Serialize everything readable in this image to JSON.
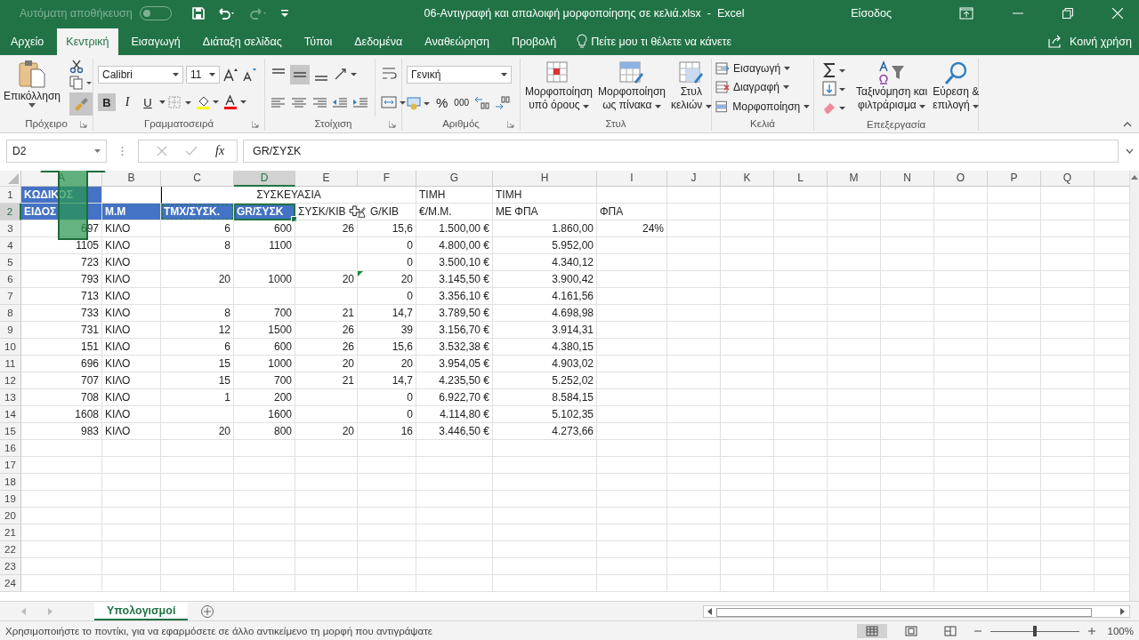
{
  "title_bar": {
    "autosave_label": "Αυτόματη αποθήκευση",
    "autosave_on": false,
    "title": "06-Αντιγραφή και απαλοιφή μορφοποίησης σε κελιά.xlsx  -  Excel",
    "sign_in": "Είσοδος"
  },
  "menu_tabs": [
    {
      "label": "Αρχείο",
      "selected": false
    },
    {
      "label": "Κεντρική",
      "selected": true
    },
    {
      "label": "Εισαγωγή",
      "selected": false
    },
    {
      "label": "Διάταξη σελίδας",
      "selected": false
    },
    {
      "label": "Τύποι",
      "selected": false
    },
    {
      "label": "Δεδομένα",
      "selected": false
    },
    {
      "label": "Αναθεώρηση",
      "selected": false
    },
    {
      "label": "Προβολή",
      "selected": false
    }
  ],
  "tell_me": "Πείτε μου τι θέλετε να κάνετε",
  "share": "Κοινή χρήση",
  "ribbon": {
    "clipboard": {
      "paste": "Επικόλληση",
      "format_painter_on": true,
      "group": "Πρόχειρο"
    },
    "font": {
      "font": "Calibri",
      "size": "11",
      "style_buttons": [
        {
          "label": "B",
          "on": true
        },
        {
          "label": "I",
          "on": false
        },
        {
          "label": "U",
          "on": false
        }
      ],
      "group": "Γραμματοσειρά"
    },
    "alignment": {
      "middle_on": true,
      "group": "Στοίχιση"
    },
    "number": {
      "format": "Γενική",
      "percent": "%",
      "thousands": "000",
      "group": "Αριθμός"
    },
    "styles": {
      "buttons": [
        {
          "line1": "Μορφοποίηση",
          "line2": "υπό όρους"
        },
        {
          "line1": "Μορφοποίηση",
          "line2": "ως πίνακα"
        },
        {
          "line1": "Στυλ",
          "line2": "κελιών"
        }
      ],
      "group": "Στυλ"
    },
    "cells": {
      "buttons": [
        "Εισαγωγή",
        "Διαγραφή",
        "Μορφοποίηση"
      ],
      "group": "Κελιά"
    },
    "editing": {
      "sort": {
        "line1": "Ταξινόμηση και",
        "line2": "φιλτράρισμα"
      },
      "find": {
        "line1": "Εύρεση &",
        "line2": "επιλογή"
      },
      "group": "Επεξεργασία"
    }
  },
  "formula_bar": {
    "name_box": "D2",
    "function_label": "fx",
    "value": "GR/ΣΥΣΚ"
  },
  "columns": [
    {
      "label": "A",
      "selected": false
    },
    {
      "label": "B",
      "selected": false
    },
    {
      "label": "C",
      "selected": false
    },
    {
      "label": "D",
      "selected": true
    },
    {
      "label": "E",
      "selected": false
    },
    {
      "label": "F",
      "selected": false
    },
    {
      "label": "G",
      "selected": false
    },
    {
      "label": "H",
      "selected": false
    },
    {
      "label": "I",
      "selected": false
    },
    {
      "label": "J",
      "selected": false
    },
    {
      "label": "K",
      "selected": false
    },
    {
      "label": "L",
      "selected": false
    },
    {
      "label": "M",
      "selected": false
    },
    {
      "label": "N",
      "selected": false
    },
    {
      "label": "O",
      "selected": false
    },
    {
      "label": "P",
      "selected": false
    },
    {
      "label": "Q",
      "selected": false
    }
  ],
  "header_rows": [
    {
      "number": "1",
      "selected": false,
      "cells": {
        "A": {
          "merged": false,
          "text": "ΚΩΔΙΚΟΣ",
          "highlighted": true,
          "selected": false,
          "copy_source": false
        },
        "C": {
          "merged": true,
          "text": "ΣΥΣΚΕΥΑΣΙΑ",
          "highlighted": false,
          "selected": false,
          "copy_source": false
        },
        "G": {
          "merged": false,
          "text": "ΤΙΜΗ",
          "highlighted": false,
          "selected": false,
          "copy_source": false
        },
        "H": {
          "merged": false,
          "text": "ΤΙΜΗ",
          "highlighted": false,
          "selected": false,
          "copy_source": false
        }
      }
    },
    {
      "number": "2",
      "selected": true,
      "cells": {
        "A": {
          "merged": false,
          "text": "ΕΙΔΟΣ",
          "highlighted": true,
          "selected": false,
          "copy_source": false
        },
        "B": {
          "merged": false,
          "text": "Μ.Μ",
          "highlighted": true,
          "selected": false,
          "copy_source": false
        },
        "C": {
          "merged": false,
          "text": "ΤΜΧ/ΣΥΣΚ.",
          "highlighted": true,
          "selected": false,
          "copy_source": true
        },
        "D": {
          "merged": false,
          "text": "GR/ΣΥΣΚ",
          "highlighted": true,
          "selected": true,
          "copy_source": false
        },
        "E": {
          "merged": false,
          "text": "ΣΥΣΚ/ΚΙΒ",
          "highlighted": false,
          "selected": false,
          "copy_source": false
        },
        "F": {
          "merged": false,
          "text": "G/ΚΙΒ",
          "highlighted": false,
          "selected": false,
          "copy_source": false
        },
        "G": {
          "merged": false,
          "text": "€/Μ.Μ.",
          "highlighted": false,
          "selected": false,
          "copy_source": false
        },
        "H": {
          "merged": false,
          "text": "ΜΕ ΦΠΑ",
          "highlighted": false,
          "selected": false,
          "copy_source": false
        },
        "I": {
          "merged": false,
          "text": "ΦΠΑ",
          "highlighted": false,
          "selected": false,
          "copy_source": false
        }
      }
    }
  ],
  "rows": [
    {
      "number": "3",
      "cells": {
        "A": "697",
        "B": "ΚΙΛΟ",
        "C": "6",
        "D": "600",
        "E": "26",
        "F": "15,6",
        "G": "1.500,00 €",
        "H": "1.860,00",
        "I": "24%"
      }
    },
    {
      "number": "4",
      "cells": {
        "A": "1105",
        "B": "ΚΙΛΟ",
        "C": "8",
        "D": "1100",
        "F": "0",
        "G": "4.800,00 €",
        "H": "5.952,00"
      }
    },
    {
      "number": "5",
      "cells": {
        "A": "723",
        "B": "ΚΙΛΟ",
        "F": "0",
        "G": "3.500,10 €",
        "H": "4.340,12"
      }
    },
    {
      "number": "6",
      "error_indicators": {
        "F": true
      },
      "cells": {
        "A": "793",
        "B": "ΚΙΛΟ",
        "C": "20",
        "D": "1000",
        "E": "20",
        "F": "20",
        "G": "3.145,50 €",
        "H": "3.900,42"
      }
    },
    {
      "number": "7",
      "cells": {
        "A": "713",
        "B": "ΚΙΛΟ",
        "F": "0",
        "G": "3.356,10 €",
        "H": "4.161,56"
      }
    },
    {
      "number": "8",
      "cells": {
        "A": "733",
        "B": "ΚΙΛΟ",
        "C": "8",
        "D": "700",
        "E": "21",
        "F": "14,7",
        "G": "3.789,50 €",
        "H": "4.698,98"
      }
    },
    {
      "number": "9",
      "cells": {
        "A": "731",
        "B": "ΚΙΛΟ",
        "C": "12",
        "D": "1500",
        "E": "26",
        "F": "39",
        "G": "3.156,70 €",
        "H": "3.914,31"
      }
    },
    {
      "number": "10",
      "cells": {
        "A": "151",
        "B": "ΚΙΛΟ",
        "C": "6",
        "D": "600",
        "E": "26",
        "F": "15,6",
        "G": "3.532,38 €",
        "H": "4.380,15"
      }
    },
    {
      "number": "11",
      "cells": {
        "A": "696",
        "B": "ΚΙΛΟ",
        "C": "15",
        "D": "1000",
        "E": "20",
        "F": "20",
        "G": "3.954,05 €",
        "H": "4.903,02"
      }
    },
    {
      "number": "12",
      "cells": {
        "A": "707",
        "B": "ΚΙΛΟ",
        "C": "15",
        "D": "700",
        "E": "21",
        "F": "14,7",
        "G": "4.235,50 €",
        "H": "5.252,02"
      }
    },
    {
      "number": "13",
      "cells": {
        "A": "708",
        "B": "ΚΙΛΟ",
        "C": "1",
        "D": "200",
        "F": "0",
        "G": "6.922,70 €",
        "H": "8.584,15"
      }
    },
    {
      "number": "14",
      "cells": {
        "A": "1608",
        "B": "ΚΙΛΟ",
        "D": "1600",
        "F": "0",
        "G": "4.114,80 €",
        "H": "5.102,35"
      }
    },
    {
      "number": "15",
      "cells": {
        "A": "983",
        "B": "ΚΙΛΟ",
        "C": "20",
        "D": "800",
        "E": "20",
        "F": "16",
        "G": "3.446,50 €",
        "H": "4.273,66"
      }
    },
    {
      "number": "16",
      "cells": {}
    },
    {
      "number": "17",
      "cells": {}
    },
    {
      "number": "18",
      "cells": {}
    },
    {
      "number": "19",
      "cells": {}
    },
    {
      "number": "20",
      "cells": {}
    },
    {
      "number": "21",
      "cells": {}
    },
    {
      "number": "22",
      "cells": {}
    },
    {
      "number": "23",
      "cells": {}
    },
    {
      "number": "24",
      "cells": {}
    }
  ],
  "sheet_tabs": [
    {
      "label": "Υπολογισμοί",
      "selected": true
    }
  ],
  "status_bar": {
    "message": "Χρησιμοποιήστε το ποντίκι, για να εφαρμόσετε σε άλλο αντικείμενο τη μορφή που αντιγράψατε",
    "zoom": "100%",
    "zoom_slider": {
      "level": 0.5
    }
  }
}
